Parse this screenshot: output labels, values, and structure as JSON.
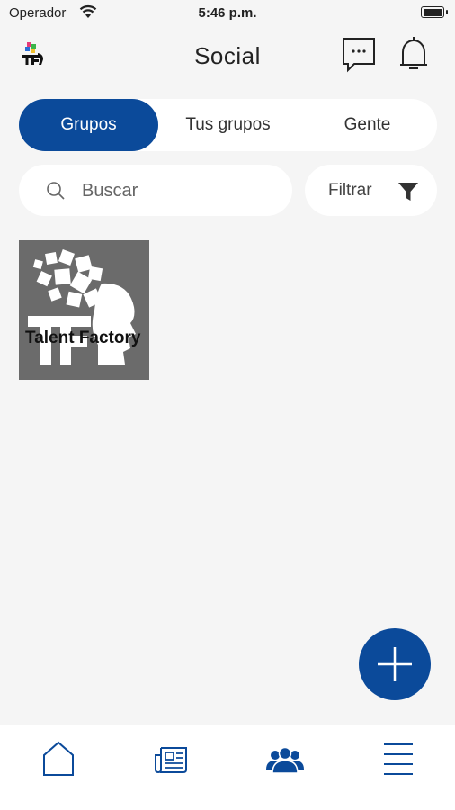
{
  "status_bar": {
    "carrier": "Operador",
    "time": "5:46 p.m."
  },
  "header": {
    "title": "Social"
  },
  "tabs": [
    {
      "label": "Grupos",
      "active": true
    },
    {
      "label": "Tus grupos",
      "active": false
    },
    {
      "label": "Gente",
      "active": false
    }
  ],
  "search": {
    "placeholder": "Buscar"
  },
  "filter": {
    "label": "Filtrar"
  },
  "groups": [
    {
      "name": "Talent Factory"
    }
  ],
  "icons": {
    "chat": "chat-bubble-icon",
    "bell": "bell-icon",
    "search": "search-icon",
    "filter": "filter-funnel-icon",
    "add": "plus-icon",
    "nav_home": "home-icon",
    "nav_news": "newspaper-icon",
    "nav_groups": "people-icon",
    "nav_menu": "menu-icon"
  },
  "colors": {
    "primary": "#0b4a9a",
    "background": "#f5f5f5",
    "surface": "#ffffff"
  }
}
